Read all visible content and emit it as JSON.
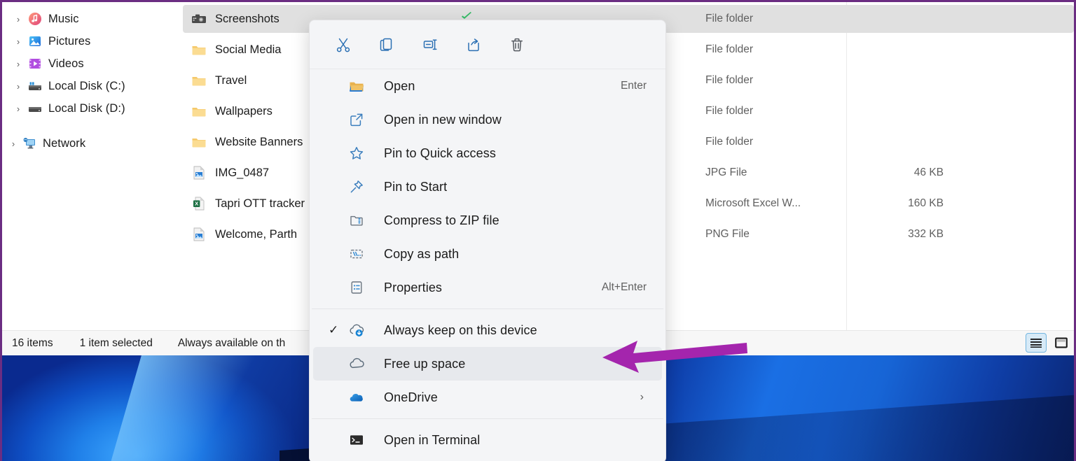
{
  "sidebar": {
    "items": [
      {
        "label": "Music",
        "icon": "music-icon",
        "chevron": "›"
      },
      {
        "label": "Pictures",
        "icon": "pictures-icon",
        "chevron": "›"
      },
      {
        "label": "Videos",
        "icon": "videos-icon",
        "chevron": "›"
      },
      {
        "label": "Local Disk (C:)",
        "icon": "drive-c-icon",
        "chevron": "›"
      },
      {
        "label": "Local Disk (D:)",
        "icon": "drive-d-icon",
        "chevron": "›"
      },
      {
        "label": "Network",
        "icon": "network-icon",
        "chevron": "›"
      }
    ]
  },
  "filelist": {
    "rows": [
      {
        "name": "Screenshots",
        "icon": "camera-folder-icon",
        "type": "File folder",
        "size": "",
        "selected": true
      },
      {
        "name": "Social Media",
        "icon": "folder-icon",
        "type": "File folder",
        "size": "",
        "selected": false
      },
      {
        "name": "Travel",
        "icon": "folder-icon",
        "type": "File folder",
        "size": "",
        "selected": false
      },
      {
        "name": "Wallpapers",
        "icon": "folder-icon",
        "type": "File folder",
        "size": "",
        "selected": false
      },
      {
        "name": "Website Banners",
        "icon": "folder-icon",
        "type": "File folder",
        "size": "",
        "selected": false
      },
      {
        "name": "IMG_0487",
        "icon": "image-file-icon",
        "type": "JPG File",
        "size": "46 KB",
        "selected": false
      },
      {
        "name": "Tapri OTT tracker",
        "icon": "excel-file-icon",
        "type": "Microsoft Excel W...",
        "size": "160 KB",
        "selected": false
      },
      {
        "name": "Welcome, Parth",
        "icon": "image-file-icon",
        "type": "PNG File",
        "size": "332 KB",
        "selected": false
      }
    ]
  },
  "statusbar": {
    "items_count": "16 items",
    "selection": "1 item selected",
    "availability": "Always available on th",
    "view_buttons": [
      {
        "name": "details-view-button",
        "icon": "details-view-icon",
        "active": true
      },
      {
        "name": "large-icons-view-button",
        "icon": "large-icons-view-icon",
        "active": false
      }
    ]
  },
  "context_menu": {
    "toolbar": [
      {
        "label": "Cut",
        "icon": "cut-icon"
      },
      {
        "label": "Copy",
        "icon": "copy-icon"
      },
      {
        "label": "Rename",
        "icon": "rename-icon"
      },
      {
        "label": "Share",
        "icon": "share-icon"
      },
      {
        "label": "Delete",
        "icon": "delete-icon"
      }
    ],
    "items": [
      {
        "label": "Open",
        "icon": "open-folder-icon",
        "accel": "Enter",
        "checked": false,
        "submenu": false,
        "highlighted": false
      },
      {
        "label": "Open in new window",
        "icon": "new-window-icon",
        "accel": "",
        "checked": false,
        "submenu": false,
        "highlighted": false
      },
      {
        "label": "Pin to Quick access",
        "icon": "star-icon",
        "accel": "",
        "checked": false,
        "submenu": false,
        "highlighted": false
      },
      {
        "label": "Pin to Start",
        "icon": "pin-icon",
        "accel": "",
        "checked": false,
        "submenu": false,
        "highlighted": false
      },
      {
        "label": "Compress to ZIP file",
        "icon": "zip-icon",
        "accel": "",
        "checked": false,
        "submenu": false,
        "highlighted": false
      },
      {
        "label": "Copy as path",
        "icon": "copy-path-icon",
        "accel": "",
        "checked": false,
        "submenu": false,
        "highlighted": false
      },
      {
        "label": "Properties",
        "icon": "properties-icon",
        "accel": "Alt+Enter",
        "checked": false,
        "submenu": false,
        "highlighted": false
      }
    ],
    "cloud_items": [
      {
        "label": "Always keep on this device",
        "icon": "cloud-keep-icon",
        "accel": "",
        "checked": true,
        "submenu": false,
        "highlighted": false
      },
      {
        "label": "Free up space",
        "icon": "cloud-free-icon",
        "accel": "",
        "checked": false,
        "submenu": false,
        "highlighted": true
      },
      {
        "label": "OneDrive",
        "icon": "onedrive-icon",
        "accel": "",
        "checked": false,
        "submenu": true,
        "highlighted": false
      }
    ],
    "terminal_items": [
      {
        "label": "Open in Terminal",
        "icon": "terminal-icon",
        "accel": "",
        "checked": false,
        "submenu": false,
        "highlighted": false
      }
    ],
    "check_glyph": "✓",
    "submenu_glyph": "›"
  },
  "annotation": {
    "arrow_color": "#a425ad",
    "points_to": "Free up space"
  },
  "colors": {
    "selection_gray": "#e0e0e0",
    "menu_bg": "#f4f5f7",
    "menu_highlight": "#e7e9ed",
    "accent_blue": "#0f6cbd",
    "folder_yellow": "#fcc75b",
    "border_purple": "#6b2d82",
    "sync_green": "#33b864"
  }
}
